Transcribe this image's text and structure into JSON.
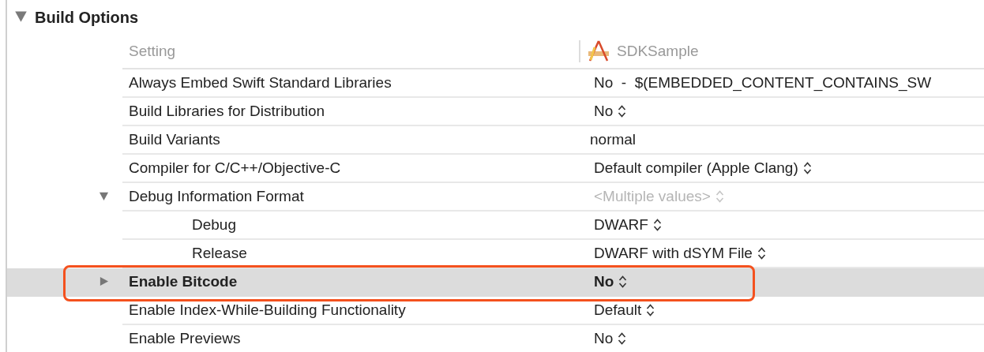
{
  "section": {
    "title": "Build Options",
    "expanded": true
  },
  "header": {
    "setting": "Setting",
    "target": "SDKSample"
  },
  "rows": [
    {
      "label": "Always Embed Swift Standard Libraries",
      "value": "No  -  $(EMBEDDED_CONTENT_CONTAINS_SW",
      "kind": "plain",
      "selected": false,
      "outlined": false
    },
    {
      "label": "Build Libraries for Distribution",
      "value": "No",
      "kind": "popup",
      "selected": false,
      "outlined": false
    },
    {
      "label": "Build Variants",
      "value": "normal",
      "kind": "text",
      "selected": false,
      "outlined": false
    },
    {
      "label": "Compiler for C/C++/Objective-C",
      "value": "Default compiler (Apple Clang)",
      "kind": "popup",
      "selected": false,
      "outlined": false
    },
    {
      "label": "Debug Information Format",
      "value": "<Multiple values>",
      "kind": "popup",
      "disabled": true,
      "expanded": true,
      "selected": false,
      "outlined": false,
      "children": [
        {
          "label": "Debug",
          "value": "DWARF",
          "kind": "popup",
          "selected": false,
          "outlined": false
        },
        {
          "label": "Release",
          "value": "DWARF with dSYM File",
          "kind": "popup",
          "selected": false,
          "outlined": false
        }
      ]
    },
    {
      "label": "Enable Bitcode",
      "value": "No",
      "kind": "popup",
      "expanded": false,
      "selected": true,
      "outlined": true
    },
    {
      "label": "Enable Index-While-Building Functionality",
      "value": "Default",
      "kind": "popup",
      "selected": false,
      "outlined": false
    },
    {
      "label": "Enable Previews",
      "value": "No",
      "kind": "popup",
      "selected": false,
      "outlined": false
    }
  ]
}
